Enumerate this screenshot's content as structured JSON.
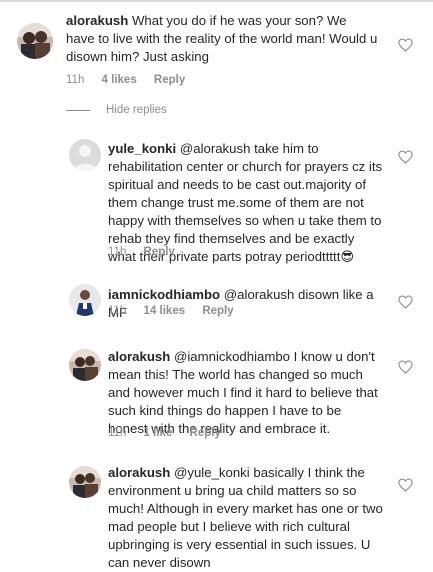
{
  "comments": [
    {
      "username": "alorakush",
      "text": "What you do if he was your son? We have to live with the reality of the world man! Would u disown him? Just asking",
      "time": "11h",
      "likes": "4 likes",
      "reply": "Reply"
    },
    {
      "username": "yule_konki",
      "mention": "@alorakush",
      "text": "take him to rehabilitation center or church for prayers cz its spiritual and needs to be cast out.majority of them change trust me.some of them are not happy with themselves so when u take them to rehab they find themselves and be exactly what their private parts potray periodttttt😎",
      "time": "11h",
      "reply": "Reply"
    },
    {
      "username": "iamnickodhiambo",
      "mention": "@alorakush",
      "text": "disown like a MF",
      "time": "11h",
      "likes": "14 likes",
      "reply": "Reply"
    },
    {
      "username": "alorakush",
      "mention": "@iamnickodhiambo",
      "text": "I know u don't mean this! The world has changed so much and however much I find it hard to believe that such kind things do happen I have to be honest with the reality and embrace it.",
      "time": "11h",
      "likes": "1 like",
      "reply": "Reply"
    },
    {
      "username": "alorakush",
      "mention": "@yule_konki",
      "text": "basically I think the environment u bring ua child matters so so much! Although in every market has one or two mad people but I believe with rich cultural upbringing is very essential in such issues. U can never disown"
    }
  ],
  "hide_replies": "Hide replies",
  "colors": {
    "text": "#262626",
    "meta": "#8e8e8e",
    "heart": "#8e8e8e"
  }
}
